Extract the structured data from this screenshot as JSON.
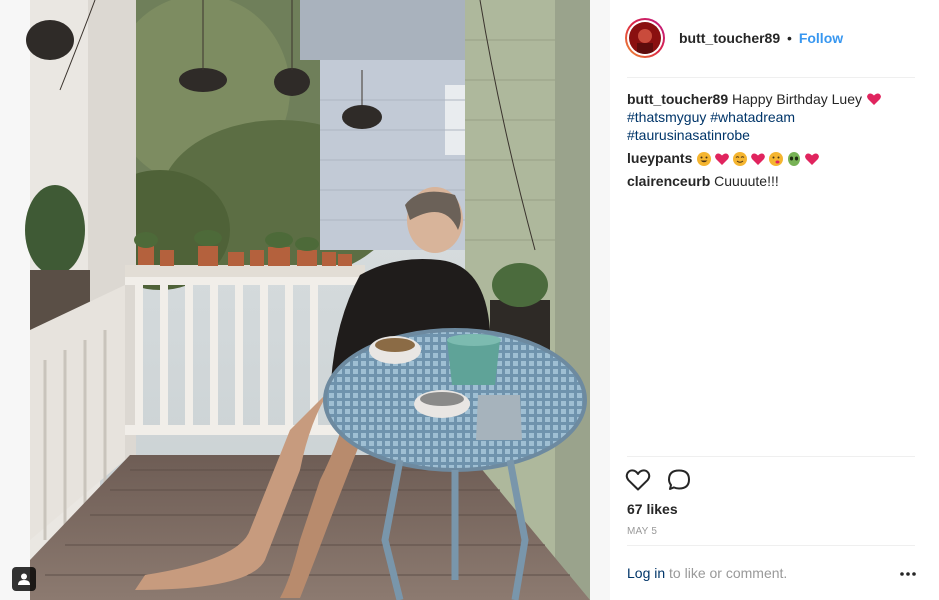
{
  "post": {
    "username": "butt_toucher89",
    "separator": "•",
    "follow_label": "Follow",
    "caption": {
      "user": "butt_toucher89",
      "text": "Happy Birthday Luey",
      "hashtags": [
        "#thatsmyguy",
        "#whatadream",
        "#taurusinasatinrobe"
      ]
    },
    "comments": [
      {
        "user": "lueypants",
        "emojis": [
          "grinning-face",
          "red-heart",
          "smiling-face",
          "red-heart",
          "savoring-face",
          "alien-face",
          "red-heart"
        ]
      },
      {
        "user": "clairenceurb",
        "text": "Cuuuute!!!"
      }
    ],
    "likes_text": "67 likes",
    "date": "MAY 5",
    "login_link": "Log in",
    "login_suffix": "to like or comment."
  },
  "icons": {
    "like": "heart-outline-icon",
    "comment": "speech-bubble-icon",
    "more": "ellipsis-icon",
    "tag": "user-tag-icon"
  },
  "colors": {
    "link": "#3897f0",
    "hashtag": "#003569",
    "muted": "#999999",
    "heart": "#e0245e"
  }
}
